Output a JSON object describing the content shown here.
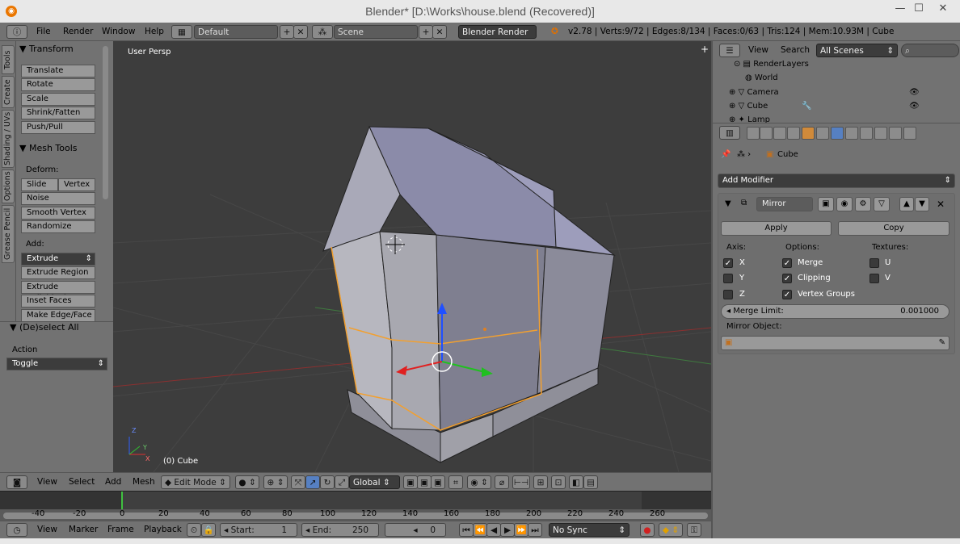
{
  "window": {
    "title": "Blender* [D:\\Works\\house.blend (Recovered)]",
    "minimize": "—",
    "maximize": "☐",
    "close": "✕"
  },
  "info": {
    "menus": [
      "File",
      "Render",
      "Window",
      "Help"
    ],
    "layout": "Default",
    "scene": "Scene",
    "engine": "Blender Render",
    "stats": "v2.78 | Verts:9/72 | Edges:8/134 | Faces:0/63 | Tris:124 | Mem:10.93M | Cube"
  },
  "lefttabs": [
    "Tools",
    "Create",
    "Shading / UVs",
    "Options",
    "Grease Pencil"
  ],
  "toolshelf": {
    "transform_header": "Transform",
    "transform_buttons": [
      "Translate",
      "Rotate",
      "Scale",
      "Shrink/Fatten",
      "Push/Pull"
    ],
    "meshtools_header": "Mesh Tools",
    "deform_label": "Deform:",
    "slide_edge": "Slide Ed",
    "vertex": "Vertex",
    "deform_buttons": [
      "Noise",
      "Smooth Vertex",
      "Randomize"
    ],
    "add_label": "Add:",
    "extrude": "Extrude",
    "add_buttons": [
      "Extrude Region",
      "Extrude Individual",
      "Inset Faces",
      "Make Edge/Face"
    ]
  },
  "redo": {
    "header": "(De)select All",
    "action_label": "Action",
    "action_value": "Toggle"
  },
  "viewport": {
    "view_name": "User Persp",
    "object_label": "(0) Cube",
    "axis_z": "Z",
    "axis_y": "Y",
    "axis_x": "X"
  },
  "v3dheader": {
    "menus": [
      "View",
      "Select",
      "Add",
      "Mesh"
    ],
    "mode": "Edit Mode",
    "orientation": "Global"
  },
  "timeline": {
    "ticks": [
      "-40",
      "-20",
      "0",
      "20",
      "40",
      "60",
      "80",
      "100",
      "120",
      "140",
      "160",
      "180",
      "200",
      "220",
      "240",
      "260"
    ]
  },
  "tlheader": {
    "menus": [
      "View",
      "Marker",
      "Frame",
      "Playback"
    ],
    "start_label": "Start:",
    "start": "1",
    "end_label": "End:",
    "end": "250",
    "current": "0",
    "sync": "No Sync"
  },
  "outliner": {
    "menus": [
      "View",
      "Search"
    ],
    "filter": "All Scenes",
    "rows": [
      "RenderLayers",
      "World",
      "Camera",
      "Cube",
      "Lamp"
    ]
  },
  "props": {
    "breadcrumb": "Cube",
    "add_modifier": "Add Modifier",
    "modifier_name": "Mirror",
    "apply": "Apply",
    "copy": "Copy",
    "axis_label": "Axis:",
    "options_label": "Options:",
    "textures_label": "Textures:",
    "axis_x": "X",
    "axis_y": "Y",
    "axis_z": "Z",
    "merge": "Merge",
    "clipping": "Clipping",
    "vertex_groups": "Vertex Groups",
    "tex_u": "U",
    "tex_v": "V",
    "merge_limit_label": "Merge Limit:",
    "merge_limit_value": "0.001000",
    "mirror_object_label": "Mirror Object:"
  }
}
